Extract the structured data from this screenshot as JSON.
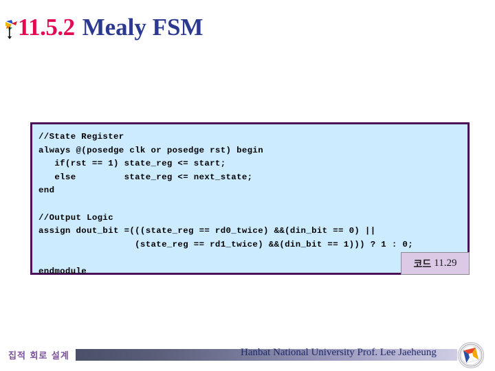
{
  "title": {
    "bullet_icon": "pinwheel-bullet-icon",
    "number": "11.5.2",
    "text": "Mealy FSM",
    "number_color": "#E20B52",
    "text_color": "#2B3990"
  },
  "code_block": {
    "language": "verilog",
    "background_color": "#CCEBFF",
    "border_color": "#4C1259",
    "text": "//State Register\nalways @(posedge clk or posedge rst) begin\n   if(rst == 1) state_reg <= start;\n   else         state_reg <= next_state;\nend\n\n//Output Logic\nassign dout_bit =(((state_reg == rd0_twice) &&(din_bit == 0) ||\n                  (state_reg == rd1_twice) &&(din_bit == 1))) ? 1 : 0;\n\nendmodule",
    "lines": [
      "//State Register",
      "always @(posedge clk or posedge rst) begin",
      "   if(rst == 1) state_reg <= start;",
      "   else         state_reg <= next_state;",
      "end",
      "",
      "//Output Logic",
      "assign dout_bit =(((state_reg == rd0_twice) &&(din_bit == 0) ||",
      "                  (state_reg == rd1_twice) &&(din_bit == 1))) ? 1 : 0;",
      "",
      "endmodule"
    ]
  },
  "caption": {
    "label_ko": "코드",
    "number": "11.29",
    "background_color": "#DBC9E6",
    "border_color": "#8A8A8A"
  },
  "footer": {
    "course_ko": "집적 회로 설계",
    "course_color": "#7B519D",
    "university": "Hanbat National University Prof. Lee Jaeheung",
    "university_color": "#1F2A66",
    "logo_icon": "hanbat-university-seal-icon",
    "bar_gradient_start": "#4A5068",
    "bar_gradient_end": "#CFCCE4"
  }
}
